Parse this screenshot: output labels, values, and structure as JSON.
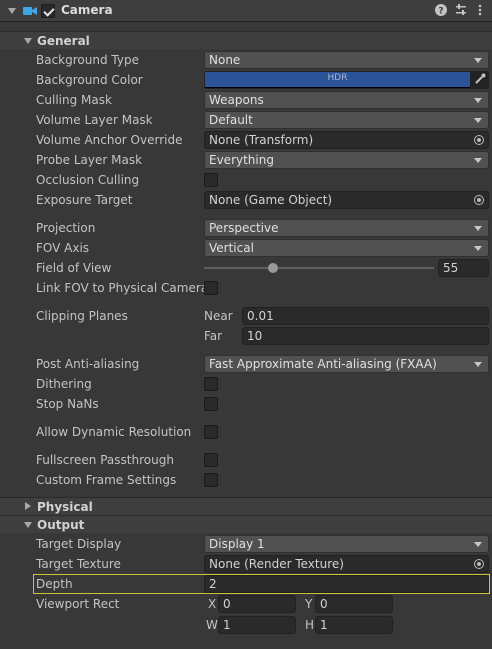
{
  "component": {
    "title": "Camera",
    "enabled": true,
    "icons": [
      "camera-icon",
      "help-icon",
      "presets-icon",
      "more-icon"
    ]
  },
  "general": {
    "title": "General",
    "background_type": {
      "label": "Background Type",
      "value": "None"
    },
    "background_color": {
      "label": "Background Color",
      "badge": "HDR",
      "color": "#2a5399"
    },
    "culling_mask": {
      "label": "Culling Mask",
      "value": "Weapons"
    },
    "volume_layer_mask": {
      "label": "Volume Layer Mask",
      "value": "Default"
    },
    "volume_anchor_override": {
      "label": "Volume Anchor Override",
      "value": "None (Transform)"
    },
    "probe_layer_mask": {
      "label": "Probe Layer Mask",
      "value": "Everything"
    },
    "occlusion_culling": {
      "label": "Occlusion Culling",
      "checked": false
    },
    "exposure_target": {
      "label": "Exposure Target",
      "value": "None (Game Object)"
    },
    "projection": {
      "label": "Projection",
      "value": "Perspective"
    },
    "fov_axis": {
      "label": "FOV Axis",
      "value": "Vertical"
    },
    "field_of_view": {
      "label": "Field of View",
      "value": "55",
      "slider_fraction": 0.3
    },
    "link_fov": {
      "label": "Link FOV to Physical Camera",
      "checked": false
    },
    "clipping_planes": {
      "label": "Clipping Planes",
      "near_label": "Near",
      "near": "0.01",
      "far_label": "Far",
      "far": "10"
    },
    "post_aa": {
      "label": "Post Anti-aliasing",
      "value": "Fast Approximate Anti-aliasing (FXAA)"
    },
    "dithering": {
      "label": "Dithering",
      "checked": false
    },
    "stop_nans": {
      "label": "Stop NaNs",
      "checked": false
    },
    "dynamic_resolution": {
      "label": "Allow Dynamic Resolution",
      "checked": false
    },
    "fullscreen_passthrough": {
      "label": "Fullscreen Passthrough",
      "checked": false
    },
    "custom_frame_settings": {
      "label": "Custom Frame Settings",
      "checked": false
    }
  },
  "physical": {
    "title": "Physical"
  },
  "output": {
    "title": "Output",
    "target_display": {
      "label": "Target Display",
      "value": "Display 1"
    },
    "target_texture": {
      "label": "Target Texture",
      "value": "None (Render Texture)"
    },
    "depth": {
      "label": "Depth",
      "value": "2"
    },
    "viewport_rect": {
      "label": "Viewport Rect",
      "x_label": "X",
      "x": "0",
      "y_label": "Y",
      "y": "0",
      "w_label": "W",
      "w": "1",
      "h_label": "H",
      "h": "1"
    }
  }
}
